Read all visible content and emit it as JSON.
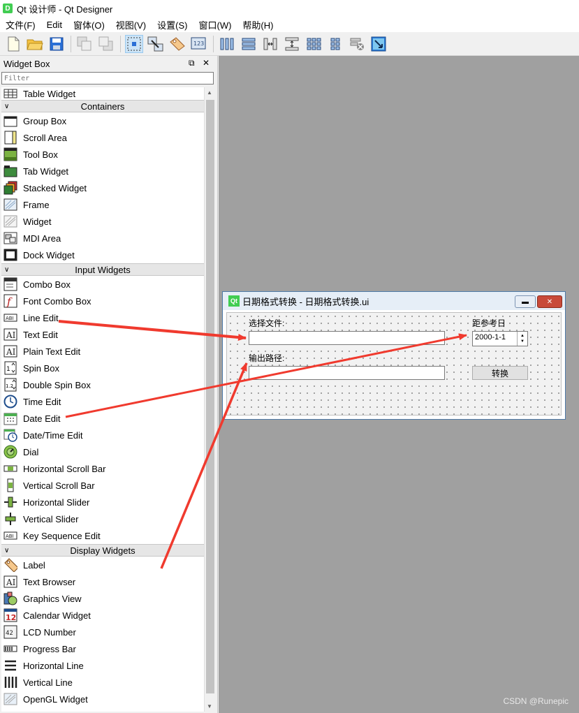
{
  "window": {
    "title": "Qt 设计师 - Qt Designer",
    "icon_letter": "D"
  },
  "menu": [
    "文件(F)",
    "Edit",
    "窗体(O)",
    "视图(V)",
    "设置(S)",
    "窗口(W)",
    "帮助(H)"
  ],
  "widget_box": {
    "title": "Widget Box",
    "filter_placeholder": "Filter",
    "top_item": "Table Widget",
    "categories": {
      "containers": {
        "label": "Containers",
        "items": [
          "Group Box",
          "Scroll Area",
          "Tool Box",
          "Tab Widget",
          "Stacked Widget",
          "Frame",
          "Widget",
          "MDI Area",
          "Dock Widget"
        ]
      },
      "input": {
        "label": "Input Widgets",
        "items": [
          "Combo Box",
          "Font Combo Box",
          "Line Edit",
          "Text Edit",
          "Plain Text Edit",
          "Spin Box",
          "Double Spin Box",
          "Time Edit",
          "Date Edit",
          "Date/Time Edit",
          "Dial",
          "Horizontal Scroll Bar",
          "Vertical Scroll Bar",
          "Horizontal Slider",
          "Vertical Slider",
          "Key Sequence Edit"
        ]
      },
      "display": {
        "label": "Display Widgets",
        "items": [
          "Label",
          "Text Browser",
          "Graphics View",
          "Calendar Widget",
          "LCD Number",
          "Progress Bar",
          "Horizontal Line",
          "Vertical Line",
          "OpenGL Widget"
        ]
      }
    }
  },
  "form": {
    "logo": "Qt",
    "title": "日期格式转换 - 日期格式转换.ui",
    "select_file_label": "选择文件:",
    "ref_date_label": "距参考日",
    "date_value": "2000-1-1",
    "output_path_label": "输出路径:",
    "convert_button": "转换"
  },
  "watermark": "CSDN @Runepic",
  "colors": {
    "arrow": "#f03a2e",
    "mdi_bg": "#a0a0a0",
    "qt_green": "#41cd52",
    "active_tool": "#cce4f7"
  }
}
